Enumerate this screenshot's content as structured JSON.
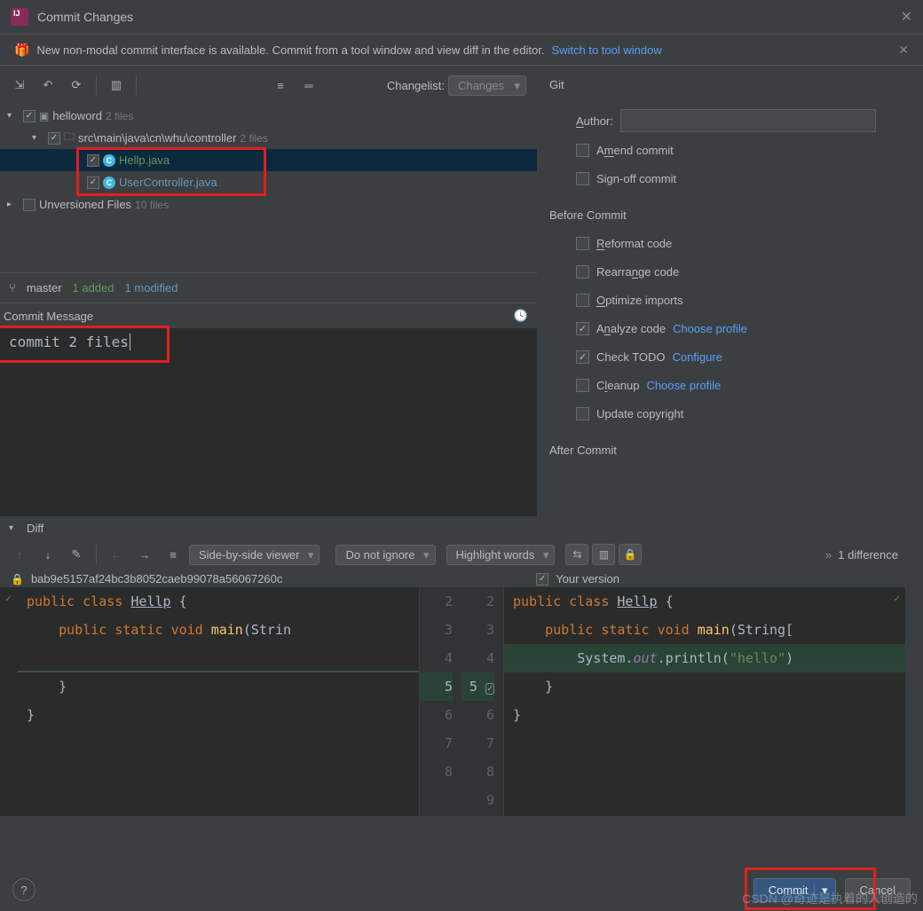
{
  "title": "Commit Changes",
  "banner": {
    "text": "New non-modal commit interface is available. Commit from a tool window and view diff in the editor.",
    "link": "Switch to tool window"
  },
  "toolbar": {
    "changelist_label": "Changelist:",
    "changelist_value": "Changes"
  },
  "tree": {
    "root": {
      "name": "helloword",
      "count": "2 files"
    },
    "pkg": {
      "path": "src\\main\\java\\cn\\whu\\controller",
      "count": "2 files"
    },
    "files": [
      {
        "name": "Hellp.java",
        "status": "added"
      },
      {
        "name": "UserController.java",
        "status": "modified"
      }
    ],
    "unversioned": {
      "name": "Unversioned Files",
      "count": "10 files"
    }
  },
  "branch": {
    "name": "master",
    "added": "1 added",
    "modified": "1 modified"
  },
  "message": {
    "header": "Commit Message",
    "text": "commit 2 files"
  },
  "git": {
    "heading": "Git",
    "author_label": "Author:",
    "amend": "Amend commit",
    "signoff": "Sign-off commit"
  },
  "before": {
    "heading": "Before Commit",
    "reformat": "Reformat code",
    "rearrange": "Rearrange code",
    "optimize": "Optimize imports",
    "analyze": "Analyze code",
    "analyze_link": "Choose profile",
    "todo": "Check TODO",
    "todo_link": "Configure",
    "cleanup": "Cleanup",
    "cleanup_link": "Choose profile",
    "copyright": "Update copyright"
  },
  "after": {
    "heading": "After Commit"
  },
  "diff": {
    "heading": "Diff",
    "viewer": "Side-by-side viewer",
    "ignore": "Do not ignore",
    "highlight": "Highlight words",
    "count": "1 difference",
    "left_hash": "bab9e5157af24bc3b8052caeb99078a56067260c",
    "right_label": "Your version",
    "left_gutter": [
      2,
      3,
      4,
      "",
      "6",
      "7",
      "8",
      ""
    ],
    "right_gutter": [
      2,
      3,
      4,
      5,
      6,
      7,
      8,
      9
    ],
    "code_left": [
      {
        "t": "public class Hellp {",
        "k": [
          [
            "public",
            "kw"
          ],
          [
            "class",
            "kw"
          ],
          [
            "Hellp",
            "cls"
          ]
        ]
      },
      {
        "t": "    public static void main(Strin",
        "k": [
          [
            "public",
            "kw"
          ],
          [
            "static",
            "kw"
          ],
          [
            "void",
            "kw"
          ],
          [
            "main",
            "mth"
          ]
        ]
      },
      {
        "t": "",
        "ins": false
      },
      {
        "t": "    }",
        "k": []
      },
      {
        "t": "}",
        "k": []
      },
      {
        "t": "",
        "k": []
      },
      {
        "t": "",
        "k": []
      }
    ],
    "code_right": [
      {
        "t": "public class Hellp {",
        "k": [
          [
            "public",
            "kw"
          ],
          [
            "class",
            "kw"
          ],
          [
            "Hellp",
            "cls"
          ]
        ]
      },
      {
        "t": "    public static void main(String[",
        "k": [
          [
            "public",
            "kw"
          ],
          [
            "static",
            "kw"
          ],
          [
            "void",
            "kw"
          ],
          [
            "main",
            "mth"
          ]
        ]
      },
      {
        "t": "        System.out.println(\"hello\")",
        "ins": true
      },
      {
        "t": "    }",
        "k": []
      },
      {
        "t": "}",
        "k": []
      },
      {
        "t": "",
        "k": []
      },
      {
        "t": "",
        "k": []
      }
    ]
  },
  "footer": {
    "commit": "Commit",
    "cancel": "Cancel"
  },
  "watermark": "CSDN @奇迹是执着的人创造的"
}
